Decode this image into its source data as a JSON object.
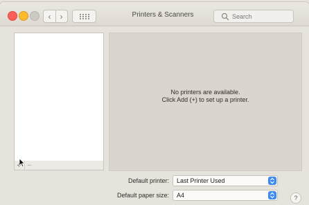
{
  "background_label": "",
  "window": {
    "title": "Printers & Scanners",
    "search": {
      "placeholder": "Search"
    }
  },
  "printer_list": {
    "add_label": "+",
    "remove_label": "−"
  },
  "details": {
    "empty_line1": "No printers are available.",
    "empty_line2": "Click Add (+) to set up a printer."
  },
  "settings": {
    "default_printer_label": "Default printer:",
    "default_printer_value": "Last Printer Used",
    "default_paper_label": "Default paper size:",
    "default_paper_value": "A4"
  },
  "help_label": "?",
  "colors": {
    "accent": "#3f8af0",
    "close": "#fb5f57",
    "minimize": "#fcbb2d"
  }
}
